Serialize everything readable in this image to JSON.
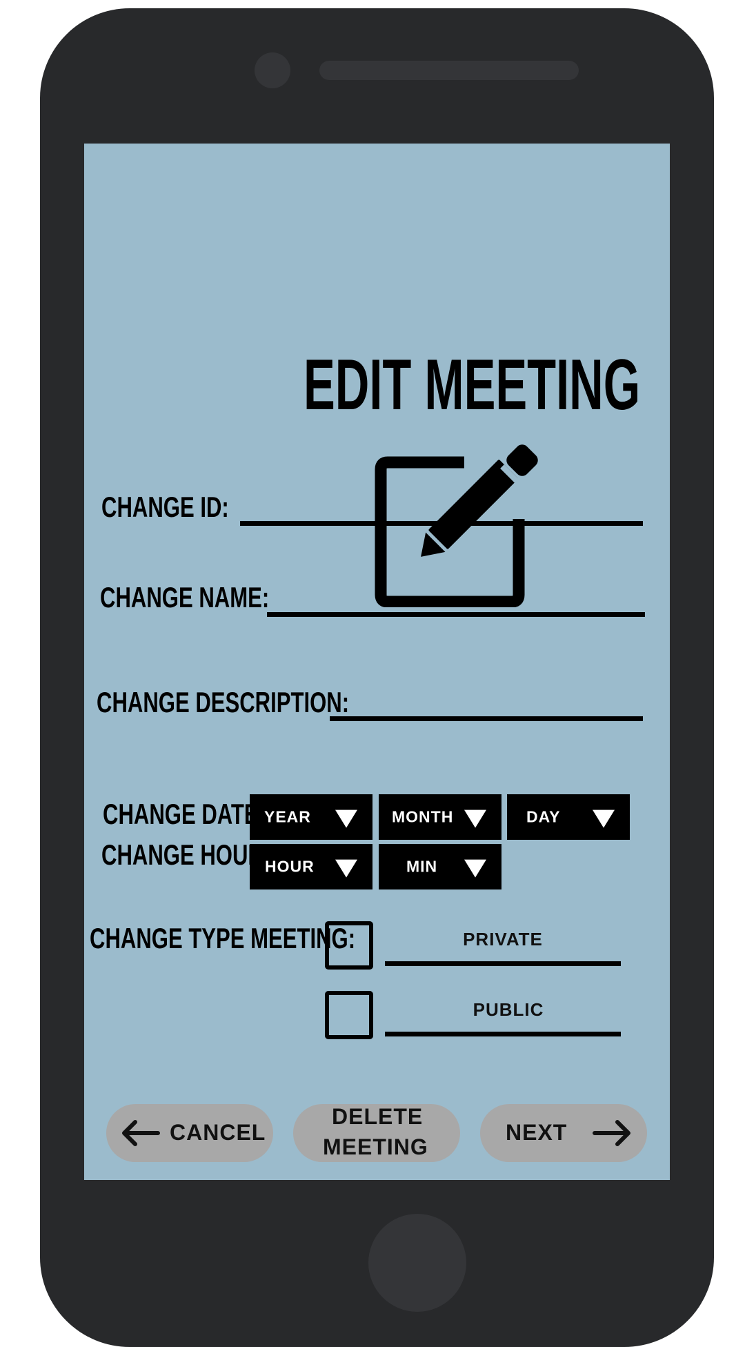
{
  "title": "EDIT MEETING",
  "icons": {
    "header": "edit-icon",
    "cancel": "arrow-left-icon",
    "next": "arrow-right-icon"
  },
  "fields": {
    "id_label": "CHANGE ID:",
    "name_label": "CHANGE NAME:",
    "description_label": "CHANGE DESCRIPTION:"
  },
  "date": {
    "label": "CHANGE DATE:",
    "year": "YEAR",
    "month": "MONTH",
    "day": "DAY"
  },
  "hour": {
    "label": "CHANGE HOUR:",
    "hour": "HOUR",
    "min": "MIN"
  },
  "type": {
    "label": "CHANGE TYPE MEETING:",
    "private": "PRIVATE",
    "public": "PUBLIC"
  },
  "buttons": {
    "cancel": "CANCEL",
    "delete_line1": "DELETE",
    "delete_line2": "MEETING",
    "next": "NEXT"
  },
  "colors": {
    "screen": "#9bbbcc",
    "device": "#28292b",
    "button": "#a8a8a8",
    "dropdown": "#000000"
  }
}
